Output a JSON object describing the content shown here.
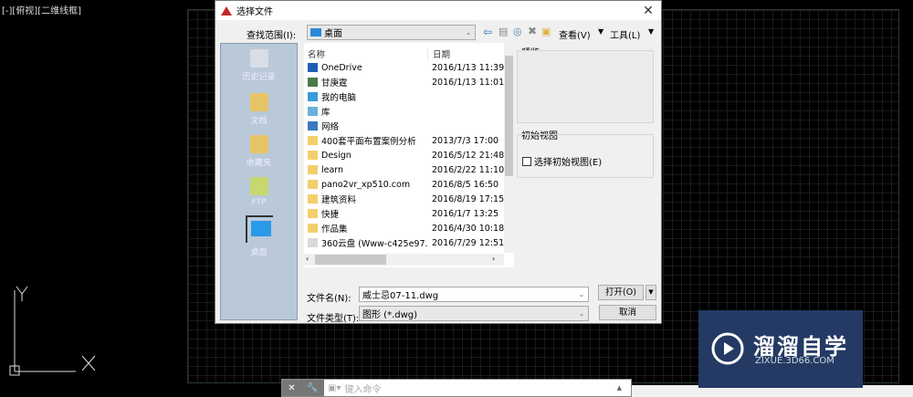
{
  "viewport": {
    "label": "[-][俯视][二维线框]"
  },
  "dialog": {
    "title": "选择文件",
    "lookin_label": "查找范围(I):",
    "lookin_value": "桌面",
    "view_menu": "查看(V)",
    "tools_menu": "工具(L)",
    "sidebar": [
      {
        "label": "历史记录"
      },
      {
        "label": "文档"
      },
      {
        "label": "收藏夹"
      },
      {
        "label": "FTP"
      },
      {
        "label": "桌面"
      }
    ],
    "columns": {
      "name": "名称",
      "date": "日期"
    },
    "files": [
      {
        "name": "OneDrive",
        "date": "2016/1/13 11:39",
        "icon": "cloud-icon",
        "color": "#1e5fb5"
      },
      {
        "name": "甘庚霆",
        "date": "2016/1/13 11:01",
        "icon": "user-icon",
        "color": "#4a7a4a"
      },
      {
        "name": "我的电脑",
        "date": "",
        "icon": "computer-icon",
        "color": "#3a9ad9"
      },
      {
        "name": "库",
        "date": "",
        "icon": "library-icon",
        "color": "#6ab0d8"
      },
      {
        "name": "网络",
        "date": "",
        "icon": "network-icon",
        "color": "#3a7ac0"
      },
      {
        "name": "400套平面布置案例分析",
        "date": "2013/7/3 17:00",
        "icon": "folder-icon",
        "color": "#f3cf6b"
      },
      {
        "name": "Design",
        "date": "2016/5/12 21:48",
        "icon": "folder-icon",
        "color": "#f3cf6b"
      },
      {
        "name": "learn",
        "date": "2016/2/22 11:10",
        "icon": "folder-icon",
        "color": "#f3cf6b"
      },
      {
        "name": "pano2vr_xp510.com",
        "date": "2016/8/5 16:50",
        "icon": "folder-icon",
        "color": "#f3cf6b"
      },
      {
        "name": "建筑资料",
        "date": "2016/8/19 17:15",
        "icon": "folder-icon",
        "color": "#f3cf6b"
      },
      {
        "name": "快捷",
        "date": "2016/1/7 13:25",
        "icon": "folder-icon",
        "color": "#f3cf6b"
      },
      {
        "name": "作品集",
        "date": "2016/4/30 10:18",
        "icon": "folder-icon",
        "color": "#f3cf6b"
      },
      {
        "name": "360云盘 (Www-c425e97...",
        "date": "2016/7/29 12:51",
        "icon": "shortcut-icon",
        "color": "#d9d9d9"
      }
    ],
    "preview_label": "预览",
    "initial_view_label": "初始视图",
    "initial_view_checkbox": "选择初始视图(E)",
    "filename_label": "文件名(N):",
    "filename_value": "威士忌07-11.dwg",
    "filetype_label": "文件类型(T):",
    "filetype_value": "图形 (*.dwg)",
    "open_button": "打开(O)",
    "cancel_button": "取消"
  },
  "command": {
    "placeholder": "键入命令"
  },
  "watermark": {
    "title": "溜溜自学",
    "url": "ZIXUE.3D66.COM"
  }
}
